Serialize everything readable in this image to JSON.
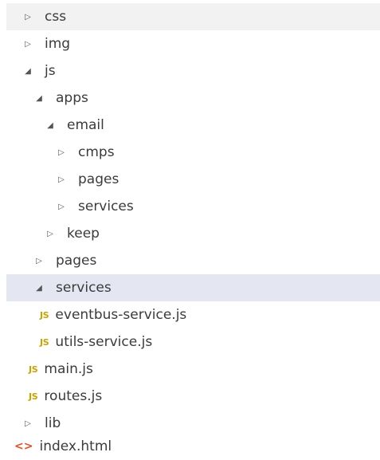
{
  "explorer": {
    "items": [
      {
        "label": "css",
        "kind": "folder",
        "state": "collapsed"
      },
      {
        "label": "img",
        "kind": "folder",
        "state": "collapsed"
      },
      {
        "label": "js",
        "kind": "folder",
        "state": "expanded"
      },
      {
        "label": "apps",
        "kind": "folder",
        "state": "expanded"
      },
      {
        "label": "email",
        "kind": "folder",
        "state": "expanded"
      },
      {
        "label": "cmps",
        "kind": "folder",
        "state": "collapsed"
      },
      {
        "label": "pages",
        "kind": "folder",
        "state": "collapsed"
      },
      {
        "label": "services",
        "kind": "folder",
        "state": "collapsed"
      },
      {
        "label": "keep",
        "kind": "folder",
        "state": "collapsed"
      },
      {
        "label": "pages",
        "kind": "folder",
        "state": "collapsed"
      },
      {
        "label": "services",
        "kind": "folder",
        "state": "expanded",
        "selected": true
      },
      {
        "label": "eventbus-service.js",
        "kind": "file-js",
        "badge": "JS"
      },
      {
        "label": "utils-service.js",
        "kind": "file-js",
        "badge": "JS"
      },
      {
        "label": "main.js",
        "kind": "file-js",
        "badge": "JS"
      },
      {
        "label": "routes.js",
        "kind": "file-js",
        "badge": "JS"
      },
      {
        "label": "lib",
        "kind": "folder",
        "state": "collapsed"
      },
      {
        "label": "index.html",
        "kind": "file-html",
        "badge": "<>"
      }
    ],
    "icons": {
      "collapsed": "▷",
      "expanded": "◢"
    },
    "colors": {
      "selected_bg": "#e4e6f1",
      "hover_bg": "#f2f2f2",
      "js_badge": "#c9a300",
      "html_badge": "#e44d26"
    }
  }
}
